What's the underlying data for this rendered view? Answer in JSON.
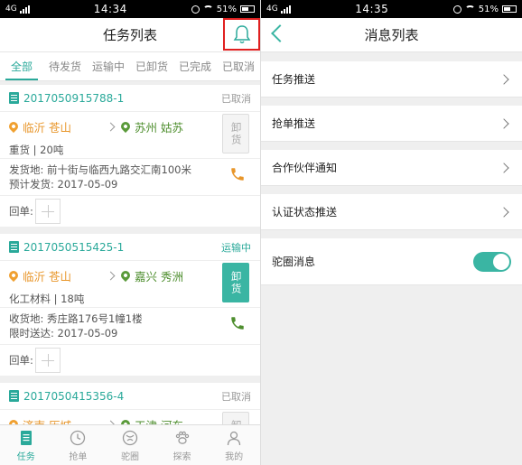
{
  "left": {
    "statusbar": {
      "network": "4G",
      "time": "14:34",
      "battery": "51%"
    },
    "title": "任务列表",
    "tabs": [
      {
        "label": "全部",
        "active": true
      },
      {
        "label": "待发货"
      },
      {
        "label": "运输中"
      },
      {
        "label": "已卸货"
      },
      {
        "label": "已完成"
      },
      {
        "label": "已取消"
      }
    ],
    "cards": [
      {
        "order_no": "2017050915788-1",
        "status": "已取消",
        "from": "临沂 苍山",
        "to": "苏州 姑苏",
        "unload": "卸货",
        "goods": "重货 | 20吨",
        "addr_line1": "发货地: 前十街与临西九路交汇南100米",
        "addr_line2": "预计发货: 2017-05-09",
        "receipt_label": "回单:"
      },
      {
        "order_no": "2017050515425-1",
        "status": "运输中",
        "from": "临沂 苍山",
        "to": "嘉兴 秀洲",
        "unload": "卸货",
        "goods": "化工材料 | 18吨",
        "addr_line1": "收货地: 秀庄路176号1幢1楼",
        "addr_line2": "限时送达: 2017-05-09",
        "receipt_label": "回单:"
      },
      {
        "order_no": "2017050415356-4",
        "status": "已取消",
        "from": "济南 历城",
        "to": "天津 河东",
        "unload": "卸货"
      }
    ],
    "nav": [
      {
        "label": "任务",
        "icon": "task-icon",
        "active": true
      },
      {
        "label": "抢单",
        "icon": "clock-icon"
      },
      {
        "label": "驼圈",
        "icon": "circle-icon"
      },
      {
        "label": "探索",
        "icon": "paw-icon"
      },
      {
        "label": "我的",
        "icon": "person-icon"
      }
    ]
  },
  "right": {
    "statusbar": {
      "network": "4G",
      "time": "14:35",
      "battery": "51%"
    },
    "title": "消息列表",
    "rows": [
      {
        "label": "任务推送"
      },
      {
        "label": "抢单推送"
      },
      {
        "label": "合作伙伴通知"
      },
      {
        "label": "认证状态推送"
      }
    ],
    "toggle_row": {
      "label": "驼圈消息",
      "on": true
    }
  },
  "colors": {
    "accent": "#2aa99a",
    "orange": "#e8962a",
    "green": "#4e8e2e",
    "highlight": "#e02020"
  }
}
